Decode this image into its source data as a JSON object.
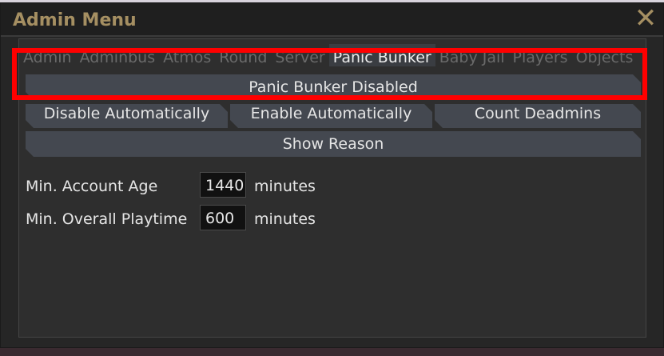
{
  "window": {
    "title": "Admin Menu",
    "close_icon": "close-icon"
  },
  "tabs": [
    {
      "label": "Admin"
    },
    {
      "label": "Adminbus"
    },
    {
      "label": "Atmos"
    },
    {
      "label": "Round"
    },
    {
      "label": "Server"
    },
    {
      "label": "Panic Bunker",
      "active": true
    },
    {
      "label": "Baby Jail"
    },
    {
      "label": "Players"
    },
    {
      "label": "Objects"
    }
  ],
  "panic_bunker": {
    "status_label": "Panic Bunker Disabled",
    "disable_auto_label": "Disable Automatically",
    "enable_auto_label": "Enable Automatically",
    "count_deadmins_label": "Count Deadmins",
    "show_reason_label": "Show Reason",
    "min_account_age": {
      "label": "Min. Account Age",
      "value": "1440",
      "unit": "minutes"
    },
    "min_overall_playtime": {
      "label": "Min. Overall Playtime",
      "value": "600",
      "unit": "minutes"
    }
  },
  "colors": {
    "title": "#a58f62",
    "highlight": "#ff0000",
    "active_tab": "#3a3d42"
  }
}
